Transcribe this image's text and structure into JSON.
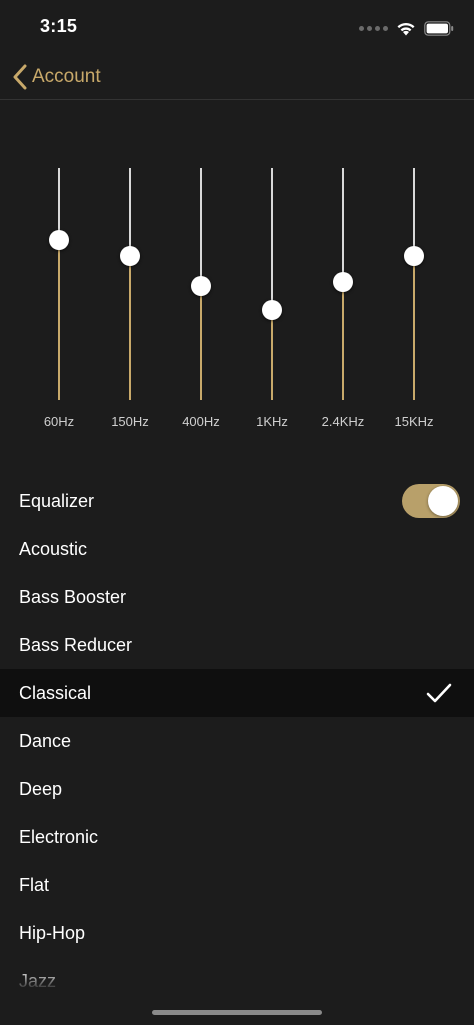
{
  "status_bar": {
    "time": "3:15"
  },
  "nav": {
    "back_label": "Account"
  },
  "equalizer": {
    "bands": [
      {
        "label": "60Hz",
        "level": 0.69
      },
      {
        "label": "150Hz",
        "level": 0.62
      },
      {
        "label": "400Hz",
        "level": 0.49
      },
      {
        "label": "1KHz",
        "level": 0.39
      },
      {
        "label": "2.4KHz",
        "level": 0.51
      },
      {
        "label": "15KHz",
        "level": 0.62
      }
    ]
  },
  "toggle_row": {
    "label": "Equalizer",
    "enabled": true
  },
  "presets": [
    {
      "label": "Acoustic",
      "selected": false
    },
    {
      "label": "Bass Booster",
      "selected": false
    },
    {
      "label": "Bass Reducer",
      "selected": false
    },
    {
      "label": "Classical",
      "selected": true
    },
    {
      "label": "Dance",
      "selected": false
    },
    {
      "label": "Deep",
      "selected": false
    },
    {
      "label": "Electronic",
      "selected": false
    },
    {
      "label": "Flat",
      "selected": false
    },
    {
      "label": "Hip-Hop",
      "selected": false
    },
    {
      "label": "Jazz",
      "selected": false
    }
  ],
  "colors": {
    "accent": "#c8a96a",
    "toggle_on": "#b8a06a",
    "background": "#1c1c1c",
    "selected_row": "#0f0f0f"
  }
}
